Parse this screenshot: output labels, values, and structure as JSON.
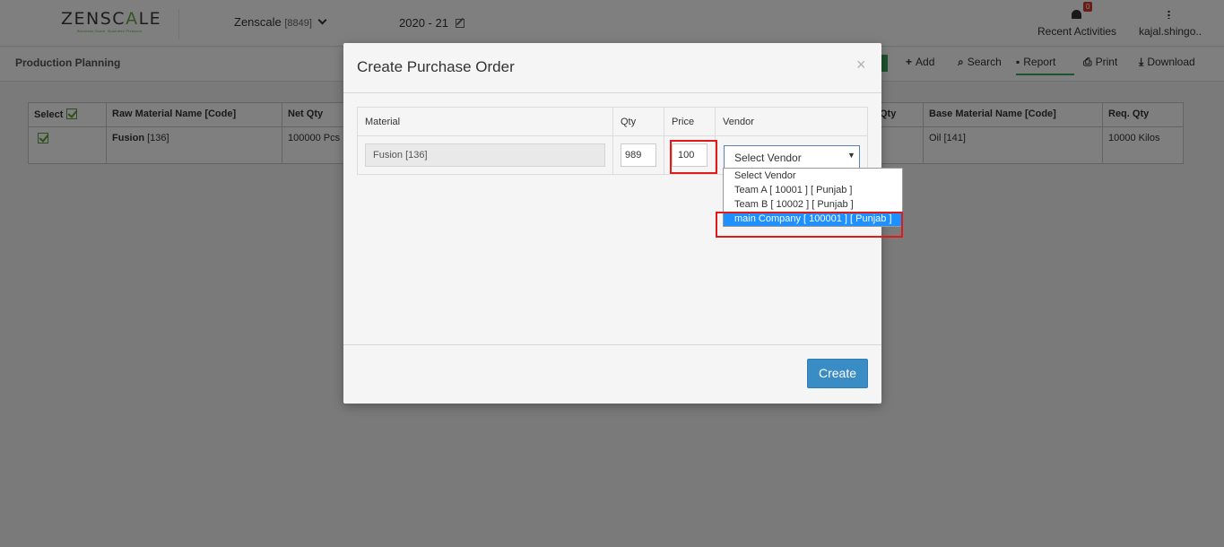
{
  "header": {
    "logo_before": "ZENSC",
    "logo_accent": "A",
    "logo_after": "LE",
    "logo_tagline": "Business Scale. Business Pleasure",
    "company": "Zenscale",
    "company_code": "[8849]",
    "fiscal_year": "2020 - 21",
    "notifications_count": "0",
    "recent_activities": "Recent Activities",
    "user": "kajal.shingo.."
  },
  "subbar": {
    "page_title": "Production Planning",
    "tools": {
      "add": "Add",
      "search": "Search",
      "report": "Report",
      "print": "Print",
      "download": "Download"
    }
  },
  "bg_table": {
    "headers": {
      "select": "Select",
      "raw_material": "Raw Material Name [Code]",
      "net_qty": "Net Qty",
      "qty": "Qty",
      "base_material": "Base Material Name [Code]",
      "req_qty": "Req. Qty"
    },
    "row": {
      "material_name": "Fusion",
      "material_code": "[136]",
      "net_qty": "100000 Pcs",
      "base_material": "Oil [141]",
      "req_qty": "10000 Kilos"
    }
  },
  "modal": {
    "title": "Create Purchase Order",
    "close": "×",
    "columns": {
      "material": "Material",
      "qty": "Qty",
      "price": "Price",
      "vendor": "Vendor"
    },
    "row": {
      "material": "Fusion [136]",
      "qty": "989",
      "price": "100",
      "vendor_selected": "Select Vendor"
    },
    "vendor_options": [
      "Select Vendor",
      "Team A [ 10001 ] [ Punjab ]",
      "Team B [ 10002 ] [ Punjab ]",
      "main Company [ 100001 ] [ Punjab ]"
    ],
    "highlighted_option_index": 3,
    "create_label": "Create"
  },
  "colors": {
    "accent_green": "#6aa842",
    "primary_button": "#3a8cc4",
    "highlight_red": "#e01a1a",
    "selected_option": "#1e90ff"
  }
}
